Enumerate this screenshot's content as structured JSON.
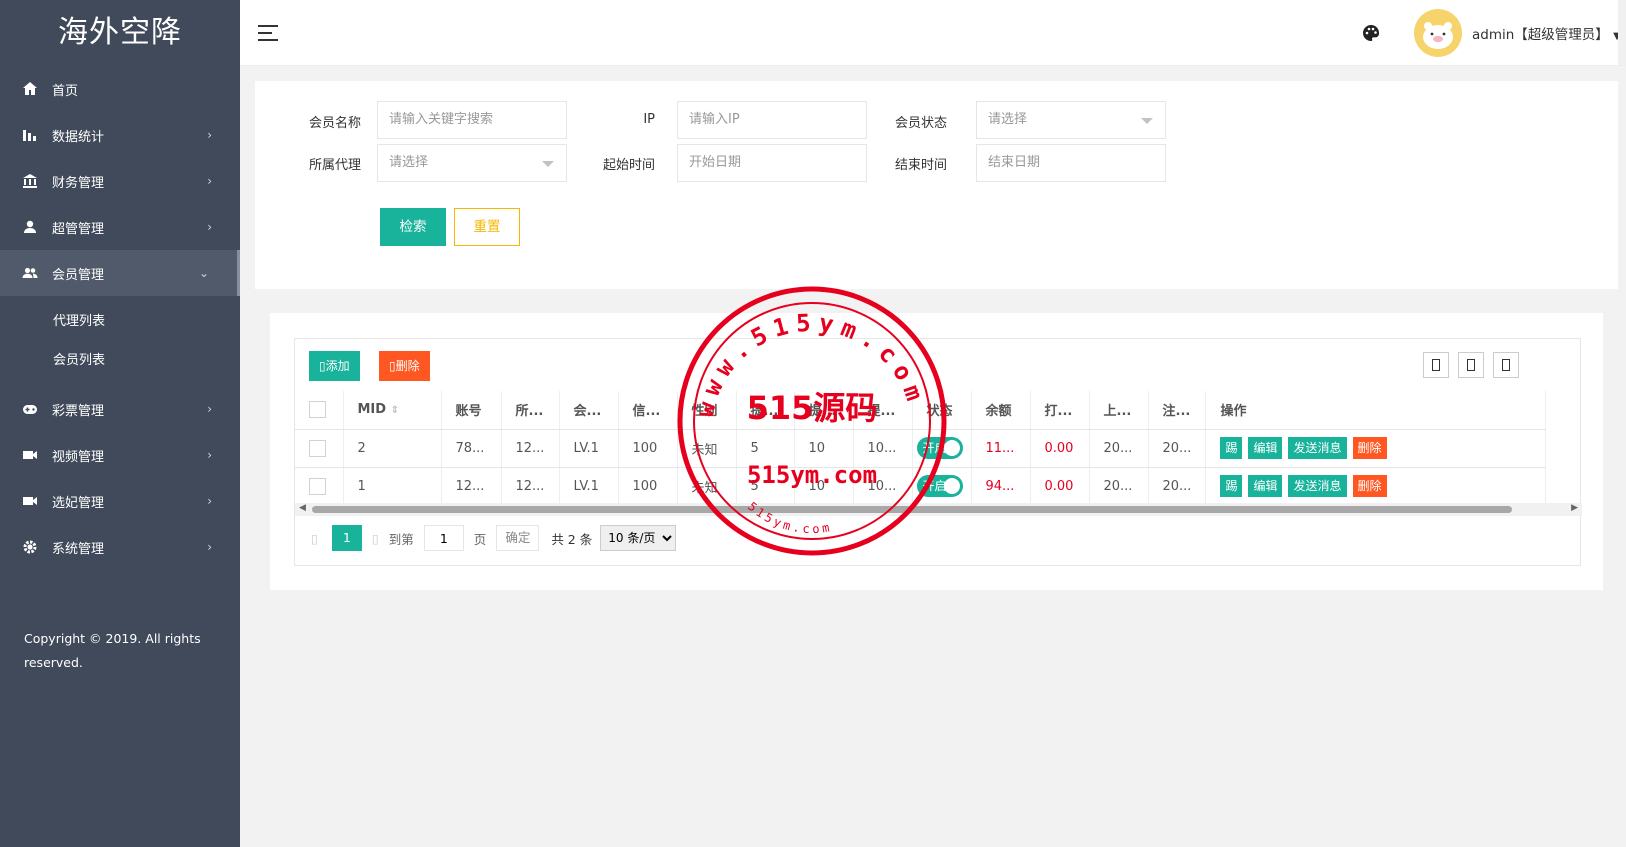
{
  "app": {
    "title": "海外空降"
  },
  "sidebar": {
    "items": [
      {
        "label": "首页",
        "icon": "home-icon"
      },
      {
        "label": "数据统计",
        "icon": "bar-chart-icon"
      },
      {
        "label": "财务管理",
        "icon": "bank-icon"
      },
      {
        "label": "超管管理",
        "icon": "user-icon"
      },
      {
        "label": "会员管理",
        "icon": "users-icon"
      },
      {
        "label": "彩票管理",
        "icon": "gamepad-icon"
      },
      {
        "label": "视频管理",
        "icon": "video-icon"
      },
      {
        "label": "选妃管理",
        "icon": "video-icon"
      },
      {
        "label": "系统管理",
        "icon": "gear-icon"
      }
    ],
    "subitems": [
      {
        "label": "代理列表"
      },
      {
        "label": "会员列表"
      }
    ],
    "copyright": "Copyright © 2019. All rights reserved."
  },
  "header": {
    "user": "admin【超级管理员】"
  },
  "filter": {
    "member_name_label": "会员名称",
    "member_name_placeholder": "请输入关键字搜索",
    "ip_label": "IP",
    "ip_placeholder": "请输入IP",
    "status_label": "会员状态",
    "status_placeholder": "请选择",
    "agent_label": "所属代理",
    "agent_placeholder": "请选择",
    "start_label": "起始时间",
    "start_placeholder": "开始日期",
    "end_label": "结束时间",
    "end_placeholder": "结束日期",
    "search_label": "检索",
    "reset_label": "重置"
  },
  "toolbar": {
    "add_label": "添加",
    "delete_label": "删除"
  },
  "table": {
    "columns": [
      "MID",
      "账号",
      "所...",
      "会...",
      "信...",
      "性别",
      "提...",
      "提...",
      "提...",
      "状态",
      "余额",
      "打...",
      "上...",
      "注...",
      "操作"
    ],
    "rows": [
      {
        "mid": "2",
        "account": "78...",
        "agent": "12...",
        "level": "LV.1",
        "credit": "100",
        "gender": "未知",
        "w1": "5",
        "w2": "10",
        "w3": "10...",
        "status": "开启",
        "balance": "11...",
        "bet": "0.00",
        "last": "20...",
        "reg": "20..."
      },
      {
        "mid": "1",
        "account": "12...",
        "agent": "12...",
        "level": "LV.1",
        "credit": "100",
        "gender": "未知",
        "w1": "5",
        "w2": "10",
        "w3": "10...",
        "status": "开启",
        "balance": "94...",
        "bet": "0.00",
        "last": "20...",
        "reg": "20..."
      }
    ],
    "actions": [
      "踢",
      "编辑",
      "发送消息",
      "删除"
    ]
  },
  "pager": {
    "current": "1",
    "goto_label": "到第",
    "goto_value": "1",
    "page_label": "页",
    "confirm_label": "确定",
    "total": "共 2 条",
    "page_size": "10 条/页"
  },
  "watermark": {
    "top_text": "www.515ym.com",
    "center_text": "515源码",
    "bottom_text": "515ym.com",
    "small_text": "515ym.com",
    "color": "#e6001e"
  }
}
